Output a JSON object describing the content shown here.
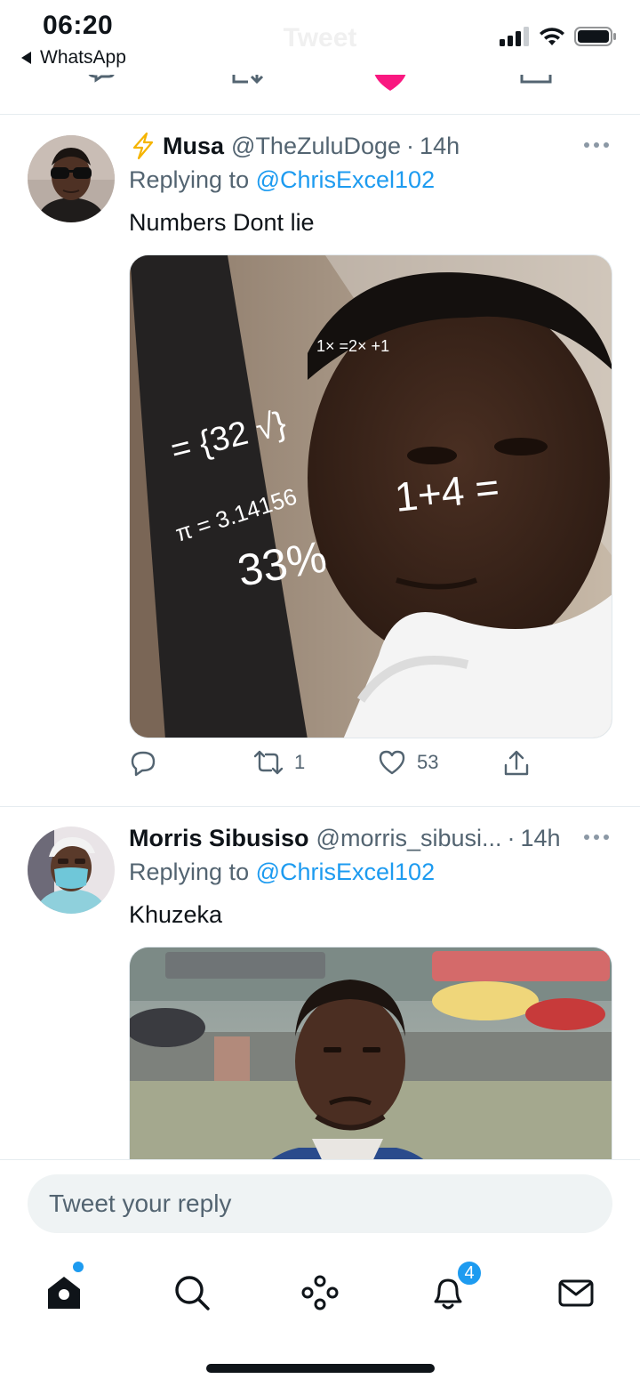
{
  "status_bar": {
    "time": "06:20",
    "back_app": "WhatsApp",
    "ghost_title": "Tweet"
  },
  "tweets": [
    {
      "name": "Musa",
      "name_prefix_icon": "lightning-icon",
      "handle": "@TheZuluDoge",
      "separator": "·",
      "time": "14h",
      "replying_prefix": "Replying to",
      "replying_to": "@ChrisExcel102",
      "text": "Numbers Dont lie",
      "media_overlay": {
        "line1": "1× =2× +1",
        "line2": "= {32 √}",
        "line3": "π = 3.14156",
        "line4": "1+4 =",
        "line5": "33%"
      },
      "retweets": "1",
      "likes": "53"
    },
    {
      "name": "Morris Sibusiso",
      "handle": "@morris_sibusi...",
      "separator": "·",
      "time": "14h",
      "replying_prefix": "Replying to",
      "replying_to": "@ChrisExcel102",
      "text": "Khuzeka"
    }
  ],
  "reply_bar": {
    "placeholder": "Tweet your reply"
  },
  "tab_bar": {
    "items": [
      "home-icon",
      "search-icon",
      "spaces-icon",
      "notifications-icon",
      "messages-icon"
    ],
    "notifications_badge": "4"
  },
  "colors": {
    "accent": "#1d9bf0",
    "like_pink": "#f91880",
    "text_secondary": "#536471"
  }
}
